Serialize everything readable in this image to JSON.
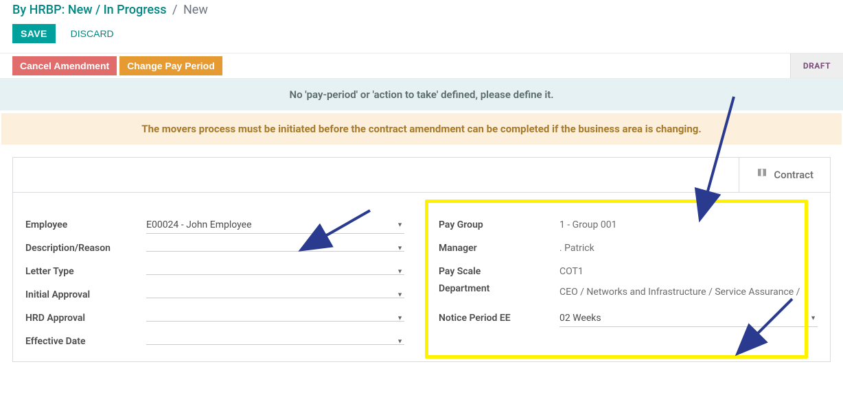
{
  "breadcrumb": {
    "parent": "By HRBP: New / In Progress",
    "current": "New"
  },
  "actions": {
    "save": "SAVE",
    "discard": "DISCARD"
  },
  "status_bar": {
    "cancel": "Cancel Amendment",
    "change": "Change Pay Period",
    "state": "DRAFT"
  },
  "alerts": {
    "info": "No 'pay-period' or 'action to take' defined, please define it.",
    "warning": "The movers process must be initiated before the contract amendment can be completed if the business area is changing."
  },
  "contract_button": "Contract",
  "left": {
    "employee": {
      "label": "Employee",
      "value": "E00024 - John Employee"
    },
    "description": {
      "label": "Description/Reason",
      "value": ""
    },
    "letter_type": {
      "label": "Letter Type",
      "value": ""
    },
    "initial_approval": {
      "label": "Initial Approval",
      "value": ""
    },
    "hrd_approval": {
      "label": "HRD Approval",
      "value": ""
    },
    "effective_date": {
      "label": "Effective Date",
      "value": ""
    }
  },
  "right": {
    "pay_group": {
      "label": "Pay Group",
      "value": "1 - Group 001"
    },
    "manager": {
      "label": "Manager",
      "value": ".             Patrick"
    },
    "pay_scale": {
      "label": "Pay Scale",
      "value": "COT1"
    },
    "department": {
      "label": "Department",
      "value": "CEO / Networks and Infrastructure / Service Assurance /"
    },
    "notice_period": {
      "label": "Notice Period EE",
      "value": "02 Weeks"
    }
  },
  "annotations": {
    "highlight_desc": "yellow highlight box on right column",
    "arrows": [
      "arrow to employee field",
      "arrow to highlight box top",
      "arrow to notice period"
    ]
  }
}
